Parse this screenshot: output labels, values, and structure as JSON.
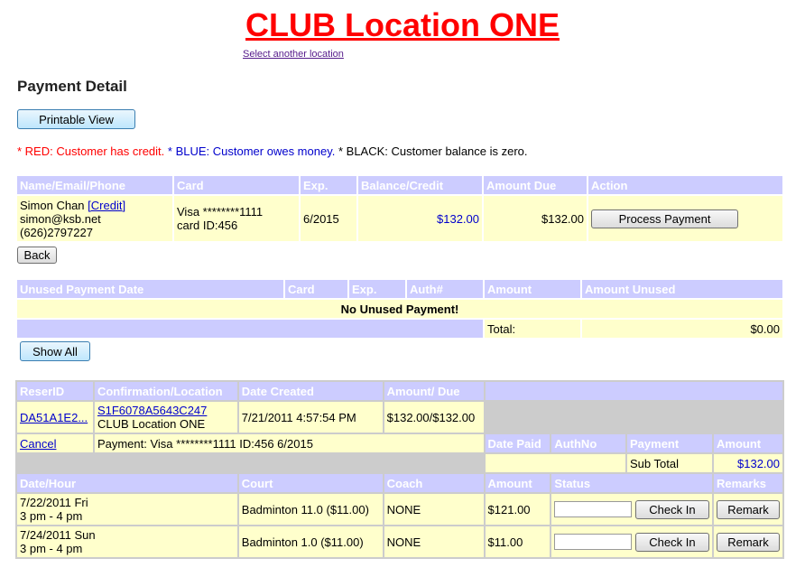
{
  "header": {
    "title": "CLUB Location ONE",
    "select_location": "Select another location",
    "page_title": "Payment Detail",
    "printable_view": "Printable View"
  },
  "legend": {
    "red": "* RED: Customer has credit.",
    "blue": "* BLUE: Customer owes money.",
    "black": "* BLACK: Customer balance is zero."
  },
  "customer_table": {
    "headers": [
      "Name/Email/Phone",
      "Card",
      "Exp.",
      "Balance/Credit",
      "Amount Due",
      "Action"
    ],
    "name": "Simon Chan",
    "credit_link": "[Credit]",
    "email": "simon@ksb.net",
    "phone": "(626)2797227",
    "card_line1": "Visa ********1111",
    "card_line2": "card ID:456",
    "exp": "6/2015",
    "balance": "$132.00",
    "amount_due": "$132.00",
    "process_button": "Process Payment"
  },
  "back_button": "Back",
  "unused_table": {
    "headers": [
      "Unused Payment Date",
      "Card",
      "Exp.",
      "Auth#",
      "Amount",
      "Amount Unused"
    ],
    "empty_message": "No Unused Payment!",
    "total_label": "Total:",
    "total_value": "$0.00"
  },
  "show_all_button": "Show All",
  "reservation_table": {
    "headers": [
      "ReserID",
      "Confirmation/Location",
      "Date Created",
      "Amount/ Due"
    ],
    "reser_id": "DA51A1E2...",
    "confirmation": "S1F6078A5643C247",
    "location": "CLUB Location ONE",
    "date_created": "7/21/2011 4:57:54 PM",
    "amount_due": "$132.00/$132.00",
    "cancel": "Cancel",
    "payment_info": "Payment: Visa ********1111 ID:456 6/2015",
    "payment_headers": [
      "Date Paid",
      "AuthNo",
      "Payment",
      "Amount"
    ],
    "subtotal_label": "Sub Total",
    "subtotal_value": "$132.00",
    "detail_headers": [
      "Date/Hour",
      "Court",
      "Coach",
      "Amount",
      "Status",
      "Remarks"
    ],
    "rows": [
      {
        "date": "7/22/2011 Fri",
        "hour": "3 pm - 4 pm",
        "court": "Badminton 11.0 ($11.00)",
        "coach": "NONE",
        "amount": "$121.00",
        "check_in": "Check In",
        "remark": "Remark"
      },
      {
        "date": "7/24/2011 Sun",
        "hour": "3 pm - 4 pm",
        "court": "Badminton 1.0 ($11.00)",
        "coach": "NONE",
        "amount": "$11.00",
        "check_in": "Check In",
        "remark": "Remark"
      }
    ]
  },
  "colors": {
    "title": "#ff0000",
    "header_bg": "#ccccff",
    "row_bg": "#ffffcc",
    "grey_bg": "#cccccc"
  }
}
